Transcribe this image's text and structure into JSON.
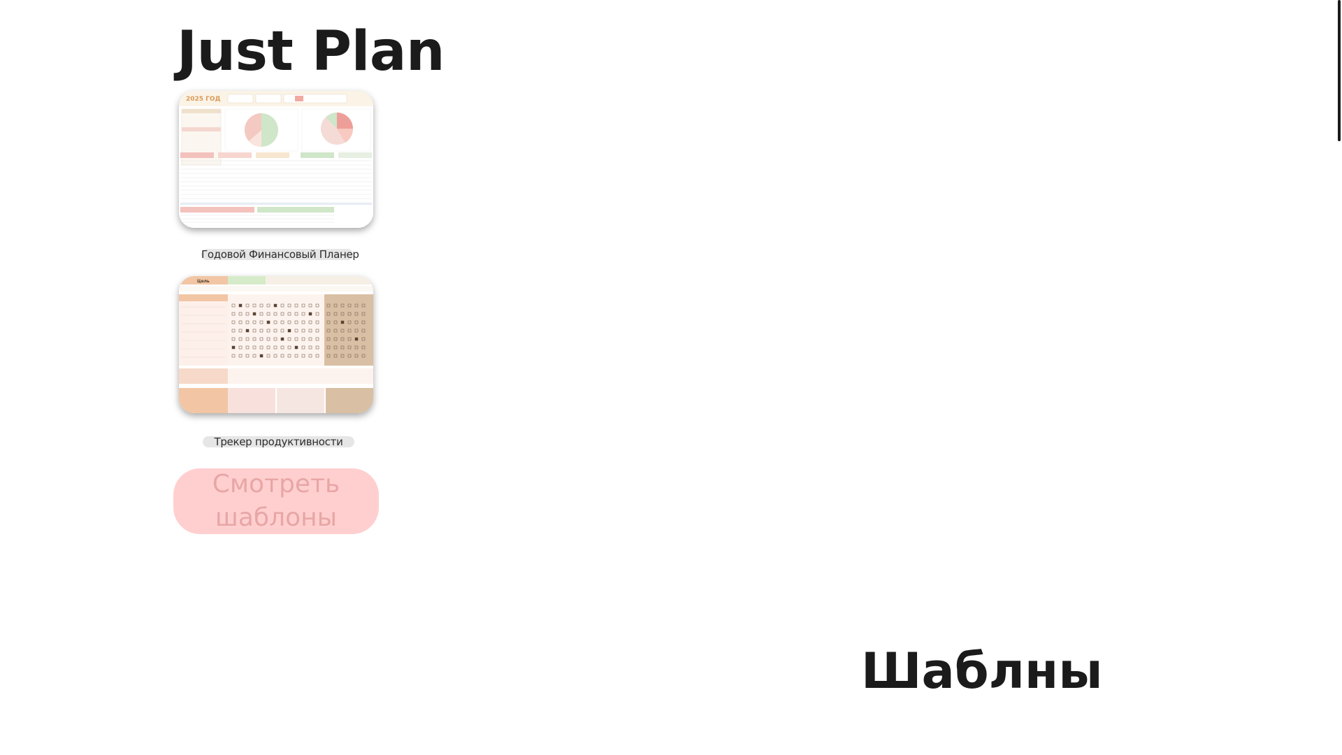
{
  "header": {
    "brand_title": "Just Plan"
  },
  "cards": [
    {
      "caption": "Годовой Финансовый Планер",
      "preview_heading": "2025 ГОД"
    },
    {
      "caption": "Трекер продуктивности",
      "preview_heading": "Цель"
    }
  ],
  "cta": {
    "label": "Смотреть\nшаблоны"
  },
  "section": {
    "title": "Шаблны"
  },
  "colors": {
    "cta_bg": "#ffcfcf",
    "cta_text": "#e8a6a6",
    "caption_bg": "#e6e6e6",
    "title": "#1b1b1b"
  }
}
